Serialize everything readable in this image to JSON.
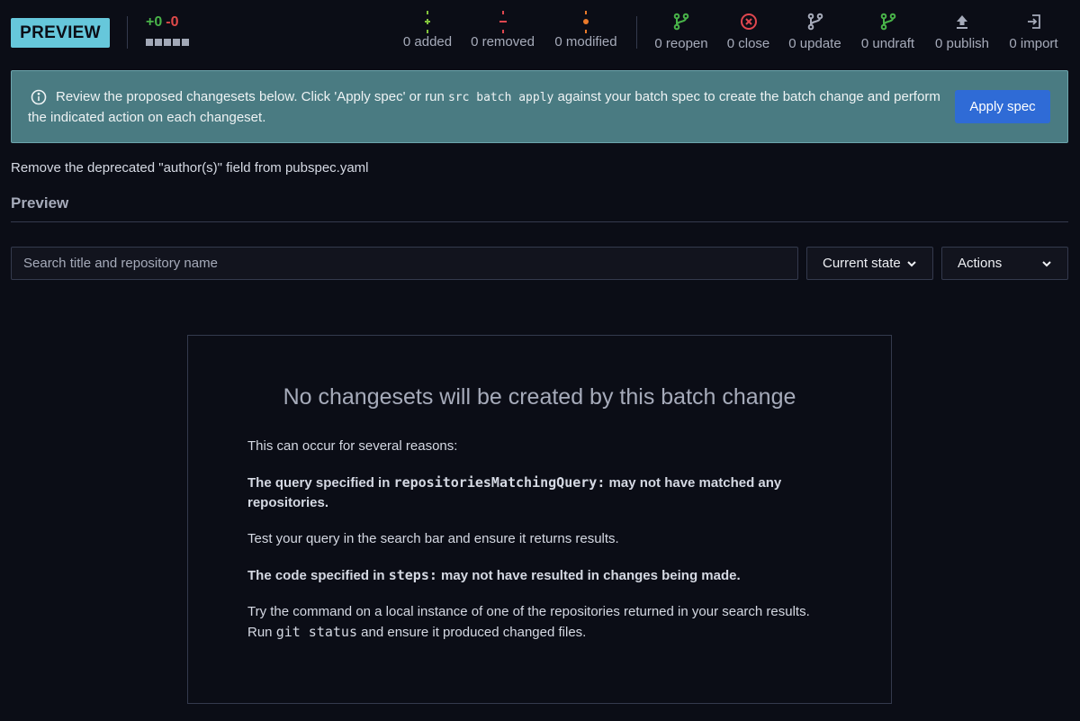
{
  "header": {
    "badge": "PREVIEW",
    "diffstat": {
      "added": "+0",
      "removed": "-0"
    },
    "stats": [
      {
        "label": "0 added",
        "icon": "plus-dotted-icon",
        "color": "#82c43c"
      },
      {
        "label": "0 removed",
        "icon": "minus-dotted-icon",
        "color": "#e0474f"
      },
      {
        "label": "0 modified",
        "icon": "dot-dotted-icon",
        "color": "#ea7a2a"
      },
      {
        "label": "0 reopen",
        "icon": "source-branch-icon",
        "color": "#49b349"
      },
      {
        "label": "0 close",
        "icon": "close-circle-icon",
        "color": "#e0474f"
      },
      {
        "label": "0 update",
        "icon": "source-branch-icon",
        "color": "#a6abba"
      },
      {
        "label": "0 undraft",
        "icon": "source-branch-icon",
        "color": "#49b349"
      },
      {
        "label": "0 publish",
        "icon": "upload-icon",
        "color": "#a6abba"
      },
      {
        "label": "0 import",
        "icon": "import-icon",
        "color": "#a6abba"
      }
    ]
  },
  "alert": {
    "text_before": "Review the proposed changesets below. Click 'Apply spec' or run ",
    "code": "src batch apply",
    "text_after": " against your batch spec to create the batch change and perform the indicated action on each changeset.",
    "button": "Apply spec"
  },
  "description": "Remove the deprecated \"author(s)\" field from pubspec.yaml",
  "section_title": "Preview",
  "filters": {
    "search_placeholder": "Search title and repository name",
    "state_select": "Current state",
    "actions_select": "Actions"
  },
  "empty_state": {
    "title": "No changesets will be created by this batch change",
    "intro": "This can occur for several reasons:",
    "reason1_prefix": "The query specified in ",
    "reason1_code": "repositoriesMatchingQuery:",
    "reason1_suffix": " may not have matched any repositories.",
    "reason1_help": "Test your query in the search bar and ensure it returns results.",
    "reason2_prefix": "The code specified in ",
    "reason2_code": "steps:",
    "reason2_suffix": " may not have resulted in changes being made.",
    "reason2_help_prefix": "Try the command on a local instance of one of the repositories returned in your search results. Run ",
    "reason2_help_code": "git status",
    "reason2_help_suffix": " and ensure it produced changed files."
  },
  "colors": {
    "background": "#0b0d16",
    "badge": "#66c7db",
    "alert_bg": "#4a7b82",
    "primary_button": "#2f6bd6",
    "green": "#49b349",
    "red": "#e04a4a"
  }
}
